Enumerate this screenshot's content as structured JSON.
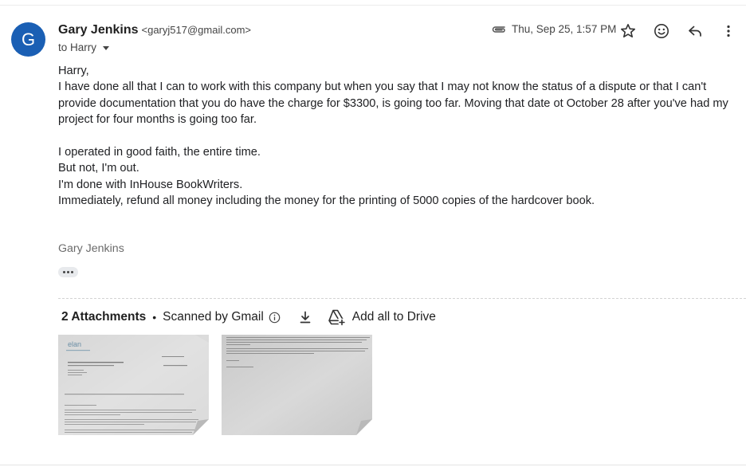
{
  "avatar": {
    "initial": "G",
    "color": "#1a5fb4"
  },
  "sender": {
    "name": "Gary Jenkins",
    "email": "<garyj517@gmail.com>",
    "to": "to Harry"
  },
  "header": {
    "date": "Thu, Sep 25, 1:57 PM"
  },
  "icons": {
    "attachment": "paperclip-icon",
    "star": "star-icon",
    "emoji": "emoji-icon",
    "reply": "reply-icon",
    "more": "more-vert-icon",
    "info": "info-icon",
    "download": "download-icon",
    "drive": "add-to-drive-icon"
  },
  "body": {
    "greeting": "Harry,",
    "paragraph1": "I have done all that I can to work with this company but when you say that I may not know the status of a dispute or that I can't provide documentation that you do have the charge for $3300, is going too far. Moving that date ot October 28 after you've had my project for four months is going too far.",
    "line1": "I operated in good faith, the entire time.",
    "line2": "But not, I'm out.",
    "line3": "I'm done with InHouse BookWriters.",
    "line4": "Immediately, refund all money including the money for the printing of 5000 copies of the hardcover book.",
    "signature": "Gary Jenkins"
  },
  "attachments": {
    "count_label": "2 Attachments",
    "separator": "•",
    "scanned_label": "Scanned by Gmail",
    "add_all_label": "Add all to Drive",
    "thumb1_logo": "elan"
  }
}
